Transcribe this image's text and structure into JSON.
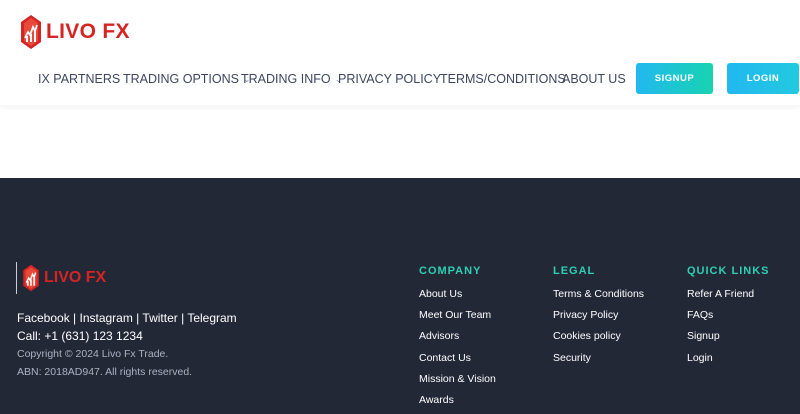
{
  "brand": {
    "name": "LIVO FX",
    "color": "#d42424"
  },
  "nav": {
    "items": [
      {
        "label": "IX PARTNERS",
        "has_dropdown": false
      },
      {
        "label": "TRADING OPTIONS",
        "has_dropdown": true
      },
      {
        "label": "TRADING INFO",
        "has_dropdown": true
      },
      {
        "label": "PRIVACY POLICY",
        "has_dropdown": false
      },
      {
        "label": "TERMS/CONDITIONS",
        "has_dropdown": false
      },
      {
        "label": "ABOUT US",
        "has_dropdown": false
      }
    ],
    "chevron": "⌄",
    "signup_label": "SIGNUP",
    "login_label": "LOGIN"
  },
  "footer": {
    "brand_name": "LIVO FX",
    "social": "Facebook | Instagram | Twitter | Telegram",
    "call": "Call: +1 (631) 123 1234",
    "copyright": "Copyright © 2024 Livo Fx Trade.",
    "abn": "ABN: 2018AD947. All rights reserved.",
    "columns": {
      "company": {
        "title": "COMPANY",
        "links": [
          "About Us",
          "Meet Our Team",
          "Advisors",
          "Contact Us",
          "Mission & Vision",
          "Awards"
        ]
      },
      "legal": {
        "title": "LEGAL",
        "links": [
          "Terms & Conditions",
          "Privacy Policy",
          "Cookies policy",
          "Security"
        ]
      },
      "quick": {
        "title": "QUICK LINKS",
        "links": [
          "Refer A Friend",
          "FAQs",
          "Signup",
          "Login"
        ]
      }
    },
    "background": "#222836",
    "accent": "#2ecfb3"
  }
}
